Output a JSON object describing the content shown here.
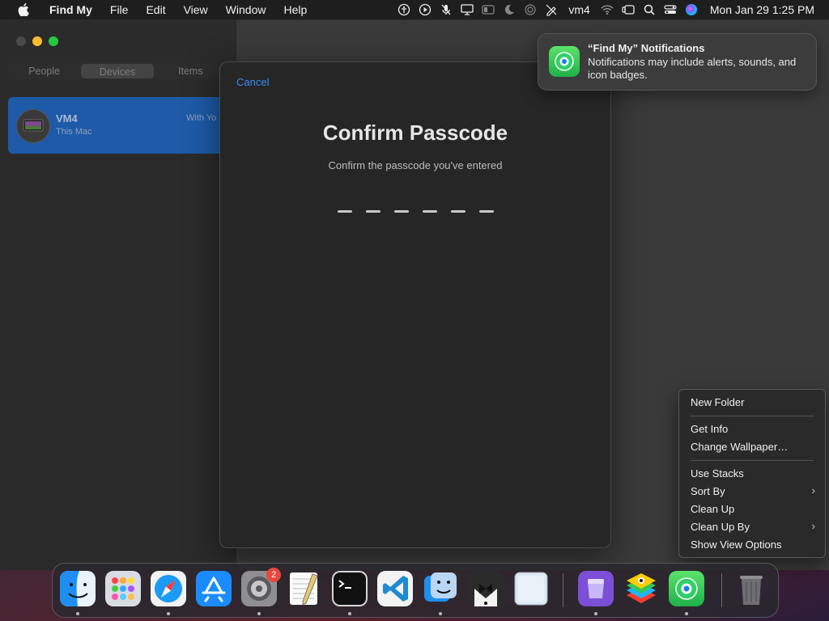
{
  "menubar": {
    "app_name": "Find My",
    "menus": [
      "File",
      "Edit",
      "View",
      "Window",
      "Help"
    ],
    "status_user": "vm4",
    "clock": "Mon Jan 29  1:25 PM"
  },
  "sidebar": {
    "tabs": [
      "People",
      "Devices",
      "Items"
    ],
    "active_tab": "Devices",
    "device": {
      "name": "VM4",
      "subtitle": "This Mac",
      "status": "With Yo"
    }
  },
  "modal": {
    "cancel_label": "Cancel",
    "title": "Confirm Passcode",
    "subtitle": "Confirm the passcode you've entered",
    "digit_count": 6
  },
  "notification": {
    "title": "“Find My” Notifications",
    "body": "Notifications may include alerts, sounds, and icon badges."
  },
  "context_menu": {
    "new_folder": "New Folder",
    "get_info": "Get Info",
    "change_wallpaper": "Change Wallpaper…",
    "use_stacks": "Use Stacks",
    "sort_by": "Sort By",
    "clean_up": "Clean Up",
    "clean_up_by": "Clean Up By",
    "show_view_options": "Show View Options"
  },
  "dock": {
    "apps": [
      "Finder",
      "Launchpad",
      "Safari",
      "App Store",
      "System Settings",
      "TextEdit",
      "Terminal",
      "Visual Studio Code",
      "Migration Assistant",
      "Bartender",
      "Preview",
      "Apple Configurator",
      "BlueStacks",
      "Find My",
      "Trash"
    ],
    "settings_badge": "2"
  },
  "colors": {
    "accent": "#3a8af7",
    "selection": "#1e5aa8",
    "badge": "#e8473e"
  }
}
